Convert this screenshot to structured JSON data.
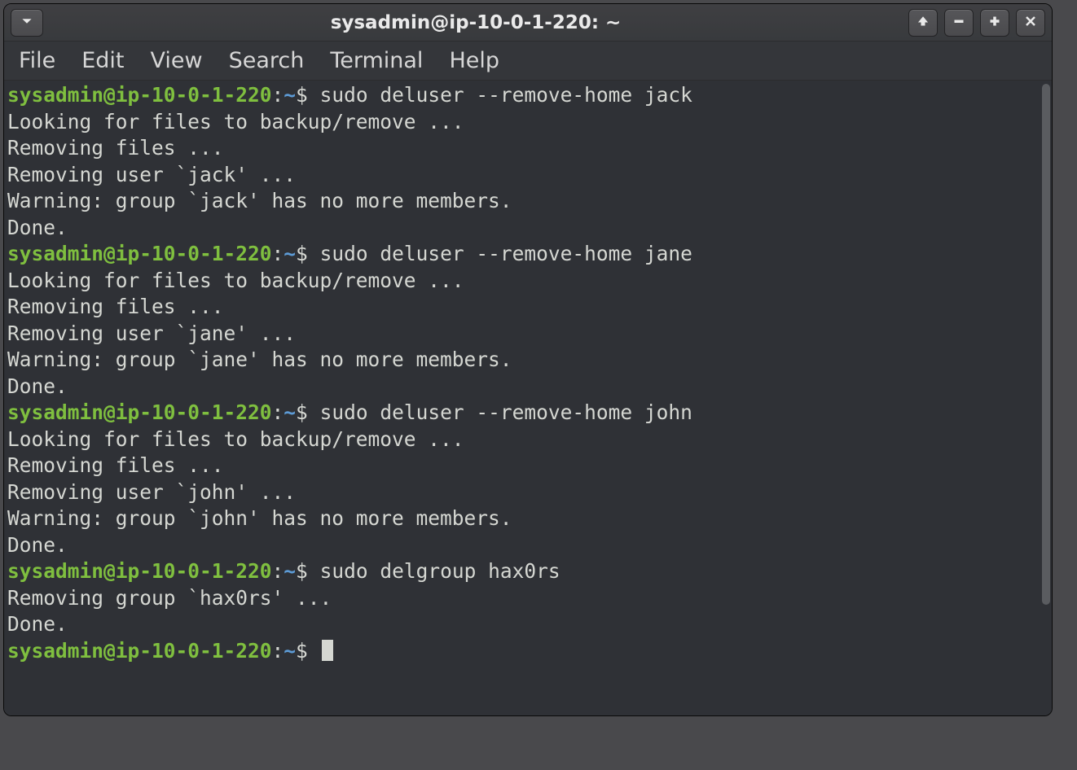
{
  "window": {
    "title": "sysadmin@ip-10-0-1-220: ~"
  },
  "menubar": {
    "items": [
      "File",
      "Edit",
      "View",
      "Search",
      "Terminal",
      "Help"
    ]
  },
  "prompt": {
    "user_host": "sysadmin@ip-10-0-1-220",
    "sep": ":",
    "path": "~",
    "symbol": "$"
  },
  "session": [
    {
      "type": "cmd",
      "text": "sudo deluser --remove-home jack"
    },
    {
      "type": "out",
      "text": "Looking for files to backup/remove ..."
    },
    {
      "type": "out",
      "text": "Removing files ..."
    },
    {
      "type": "out",
      "text": "Removing user `jack' ..."
    },
    {
      "type": "out",
      "text": "Warning: group `jack' has no more members."
    },
    {
      "type": "out",
      "text": "Done."
    },
    {
      "type": "cmd",
      "text": "sudo deluser --remove-home jane"
    },
    {
      "type": "out",
      "text": "Looking for files to backup/remove ..."
    },
    {
      "type": "out",
      "text": "Removing files ..."
    },
    {
      "type": "out",
      "text": "Removing user `jane' ..."
    },
    {
      "type": "out",
      "text": "Warning: group `jane' has no more members."
    },
    {
      "type": "out",
      "text": "Done."
    },
    {
      "type": "cmd",
      "text": "sudo deluser --remove-home john"
    },
    {
      "type": "out",
      "text": "Looking for files to backup/remove ..."
    },
    {
      "type": "out",
      "text": "Removing files ..."
    },
    {
      "type": "out",
      "text": "Removing user `john' ..."
    },
    {
      "type": "out",
      "text": "Warning: group `john' has no more members."
    },
    {
      "type": "out",
      "text": "Done."
    },
    {
      "type": "cmd",
      "text": "sudo delgroup hax0rs"
    },
    {
      "type": "out",
      "text": "Removing group `hax0rs' ..."
    },
    {
      "type": "out",
      "text": "Done."
    },
    {
      "type": "prompt-only"
    }
  ],
  "icons": {
    "dropdown": "chevron-down-icon",
    "up": "arrow-up-icon",
    "minimize": "minimize-icon",
    "maximize": "maximize-icon",
    "close": "close-icon"
  }
}
